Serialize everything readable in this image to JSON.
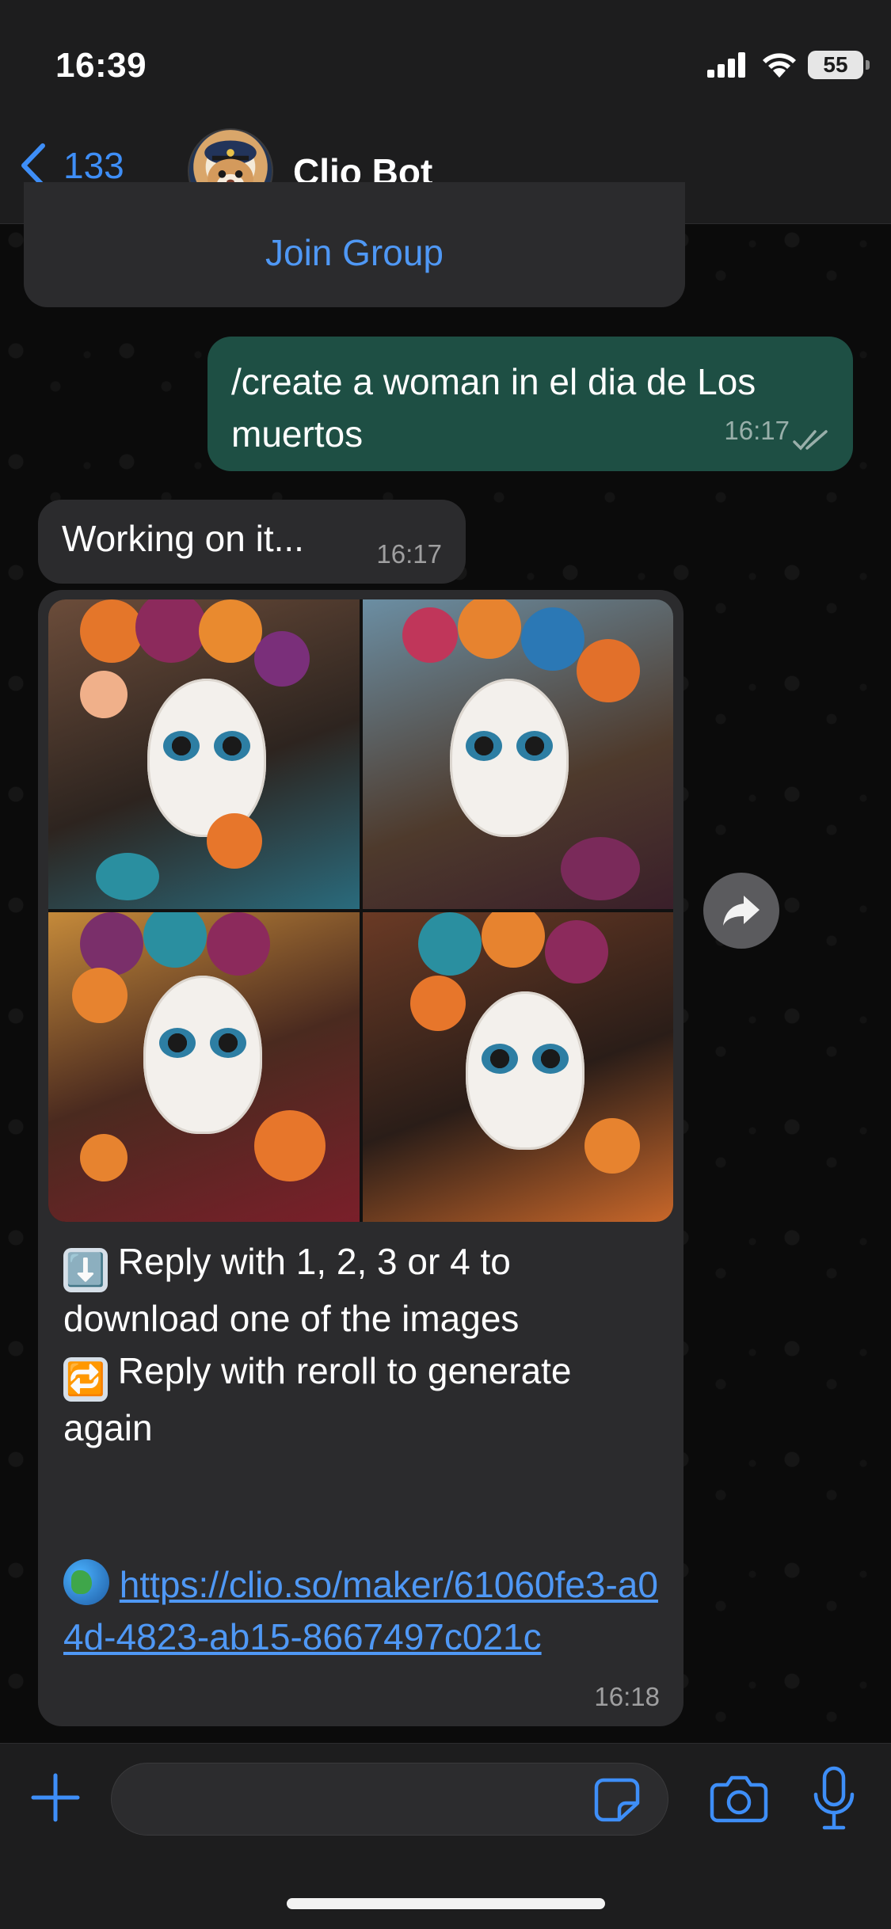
{
  "status_bar": {
    "time": "16:39",
    "battery": "55"
  },
  "header": {
    "back_count": "133",
    "chat_name": "Clio Bot"
  },
  "messages": {
    "join": {
      "label": "Join Group"
    },
    "sent": {
      "text": "/create a woman in el dia de Los muertos",
      "time": "16:17"
    },
    "working": {
      "text": "Working on it...",
      "time": "16:17"
    },
    "media": {
      "line1_emoji": "⬇️",
      "line1": "Reply with 1, 2, 3 or 4 to download one of the images",
      "line2_emoji": "🔁",
      "line2": "Reply with reroll to generate again",
      "link_emoji": "🌎",
      "link": "https://clio.so/maker/61060fe3-a04d-4823-ab15-8667497c021c",
      "time": "16:18"
    }
  },
  "icons": {
    "back": "chevron-left-icon",
    "forward": "forward-arrow-icon",
    "plus": "plus-icon",
    "sticker": "sticker-icon",
    "camera": "camera-icon",
    "mic": "microphone-icon",
    "ticks": "double-check-icon"
  },
  "colors": {
    "accent": "#3e8ef7",
    "outgoing_bubble": "#1e4f44",
    "incoming_bubble": "#2b2b2d",
    "bar_background": "#1d1d1e"
  }
}
